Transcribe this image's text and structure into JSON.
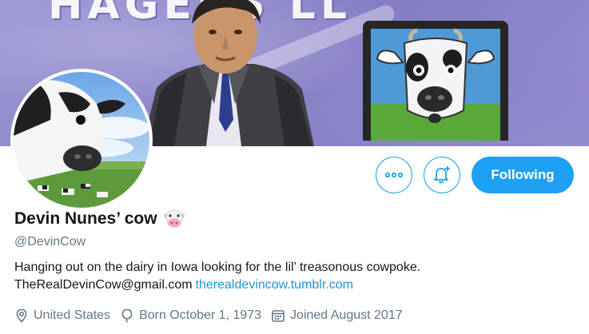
{
  "profile": {
    "display_name": "Devin Nunes’ cow",
    "handle": "@DevinCow",
    "bio_text": "Hanging out on the dairy in Iowa looking for the lil’ treasonous cowpoke.",
    "email": "TheRealDevinCow@gmail.com",
    "website": "therealdevincow.tumblr.com",
    "location": "United States",
    "birthday": "Born October 1, 1973",
    "joined": "Joined August 2017",
    "name_emoji": "cow-face-icon"
  },
  "actions": {
    "more_icon": "more-icon",
    "notify_icon": "notification-bell-plus-icon",
    "following_label": "Following"
  },
  "icons": {
    "location": "location-pin-icon",
    "birthday": "balloon-icon",
    "joined": "calendar-icon"
  },
  "colors": {
    "accent": "#1da1f2",
    "link": "#1b95e0",
    "secondary_text": "#657786",
    "banner": "#8d86c9"
  }
}
